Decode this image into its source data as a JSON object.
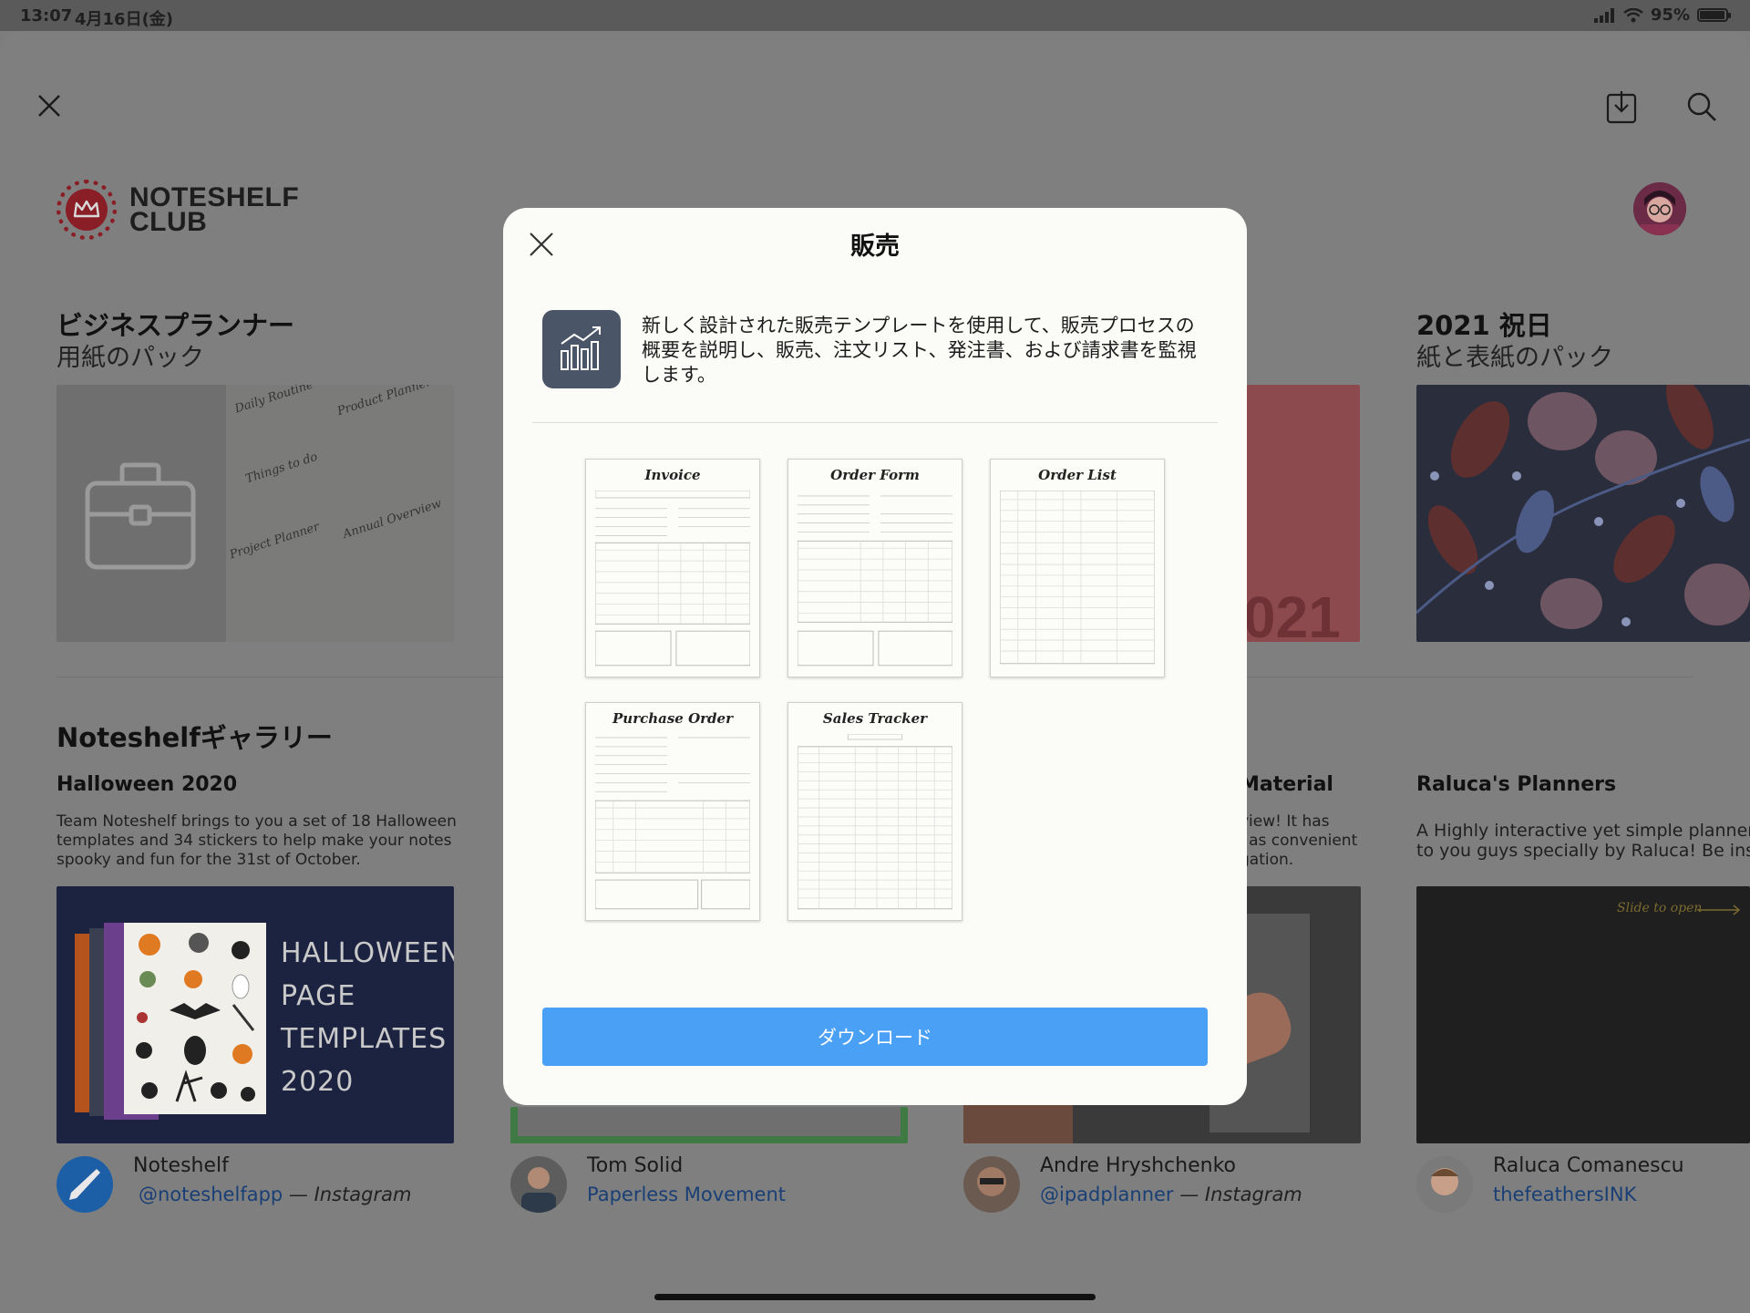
{
  "status_bar": {
    "time": "13:07",
    "date": "4月16日(金)",
    "battery": "95%",
    "battery_level": 0.95
  },
  "header": {
    "logo_line1": "NOTESHELF",
    "logo_line2": "CLUB",
    "icons": [
      "close-icon",
      "download-icon",
      "search-icon"
    ]
  },
  "sections": {
    "business": {
      "title": "ビジネスプランナー",
      "subtitle": "用紙のパック",
      "thumb_labels": [
        "Daily Routine",
        "Product Planner",
        "Things to do",
        "Project Planner",
        "Annual Overview"
      ]
    },
    "holidays": {
      "title": "2021 祝日",
      "subtitle": "紙と表紙のパック"
    },
    "middle_card_label": "021",
    "gallery": {
      "title": "Noteshelfギャラリー"
    }
  },
  "gallery_cards": [
    {
      "title": "Halloween 2020",
      "desc_lines": [
        "Team Noteshelf brings to you a set of 18 Halloween",
        "templates and 34 stickers to help make your notes",
        "spooky and fun for the 31st of October."
      ],
      "image_lines": [
        "HALLOWEEN",
        "PAGE",
        "TEMPLATES",
        "2020"
      ],
      "author": "Noteshelf",
      "handle": "@noteshelfapp",
      "source": " — Instagram"
    },
    {
      "author": "Tom Solid",
      "handle": "Paperless Movement"
    },
    {
      "title_fragment": "Material",
      "desc_lines": [
        "view! It has",
        "l as convenient",
        "gation."
      ],
      "author": "Andre Hryshchenko",
      "handle": "@ipadplanner",
      "source": " — Instagram"
    },
    {
      "title": "Raluca's Planners",
      "desc_lines": [
        "A Highly interactive yet simple planner b",
        "to you guys specially by Raluca! Be insp"
      ],
      "image_text": "Slide to open",
      "author": "Raluca Comanescu",
      "handle": "thefeathersINK"
    }
  ],
  "modal": {
    "title": "販売",
    "description": "新しく設計された販売テンプレートを使用して、販売プロセスの概要を説明し、販売、注文リスト、発注書、および請求書を監視します。",
    "templates": [
      "Invoice",
      "Order Form",
      "Order List",
      "Purchase Order",
      "Sales Tracker"
    ],
    "download_label": "ダウンロード",
    "colors": {
      "button": "#4aa0f4",
      "icon_bg": "#4a5568"
    }
  }
}
